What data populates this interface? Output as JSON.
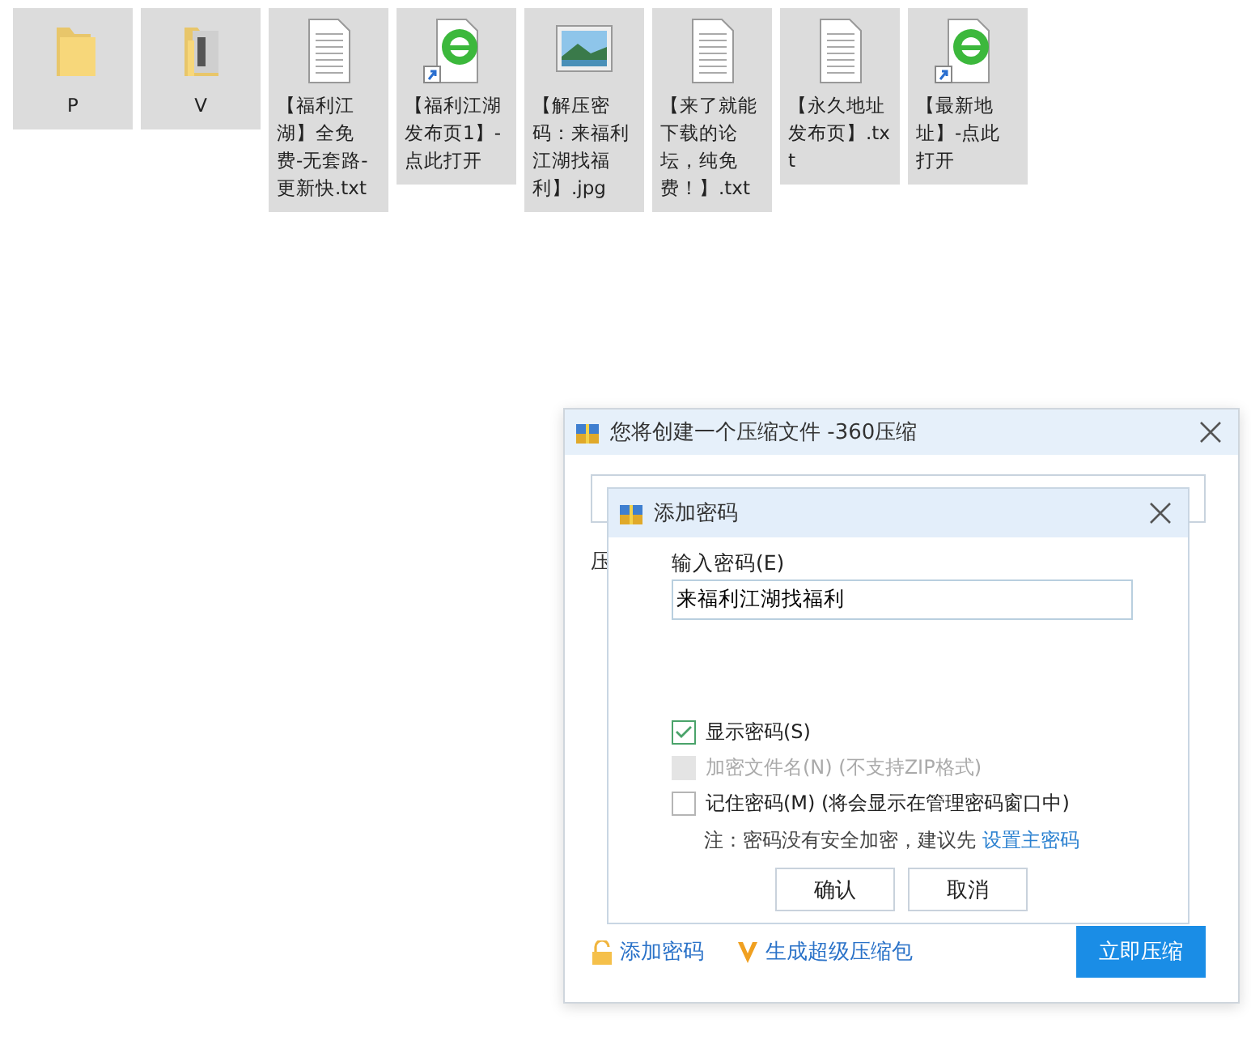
{
  "desktop": {
    "items": [
      {
        "name": "P",
        "kind": "folder"
      },
      {
        "name": "V",
        "kind": "photo_folder"
      },
      {
        "name": "【福利江湖】全免费-无套路-更新快.txt",
        "kind": "text"
      },
      {
        "name": "【福利江湖发布页1】-点此打开",
        "kind": "web_shortcut"
      },
      {
        "name": "【解压密码：来福利江湖找福利】.jpg",
        "kind": "image"
      },
      {
        "name": "【来了就能下载的论坛，纯免费！】.txt",
        "kind": "text"
      },
      {
        "name": "【永久地址发布页】.txt",
        "kind": "text"
      },
      {
        "name": "【最新地址】-点此打开",
        "kind": "web_shortcut"
      }
    ]
  },
  "dialog": {
    "title": "您将创建一个压缩文件 -360压缩",
    "label": "压",
    "footer_links": [
      {
        "label": "添加密码",
        "kind": "lock"
      },
      {
        "label": "生成超级压缩包",
        "kind": "v"
      }
    ],
    "primary_button": "立即压缩",
    "password_dialog": {
      "title": "添加密码",
      "password_label": "输入密码(E)",
      "password": "来福利江湖找福利",
      "options": [
        {
          "label": "显示密码(S)",
          "checked": true,
          "disabled": false
        },
        {
          "label": "加密文件名(N) (不支持ZIP格式)",
          "checked": false,
          "disabled": true
        },
        {
          "label": "记住密码(M) (将会显示在管理密码窗口中)",
          "checked": false,
          "disabled": false
        }
      ],
      "note": "注：密码没有安全加密，建议先",
      "note_link": "设置主密码",
      "buttons": [
        "确认",
        "取消"
      ]
    }
  }
}
